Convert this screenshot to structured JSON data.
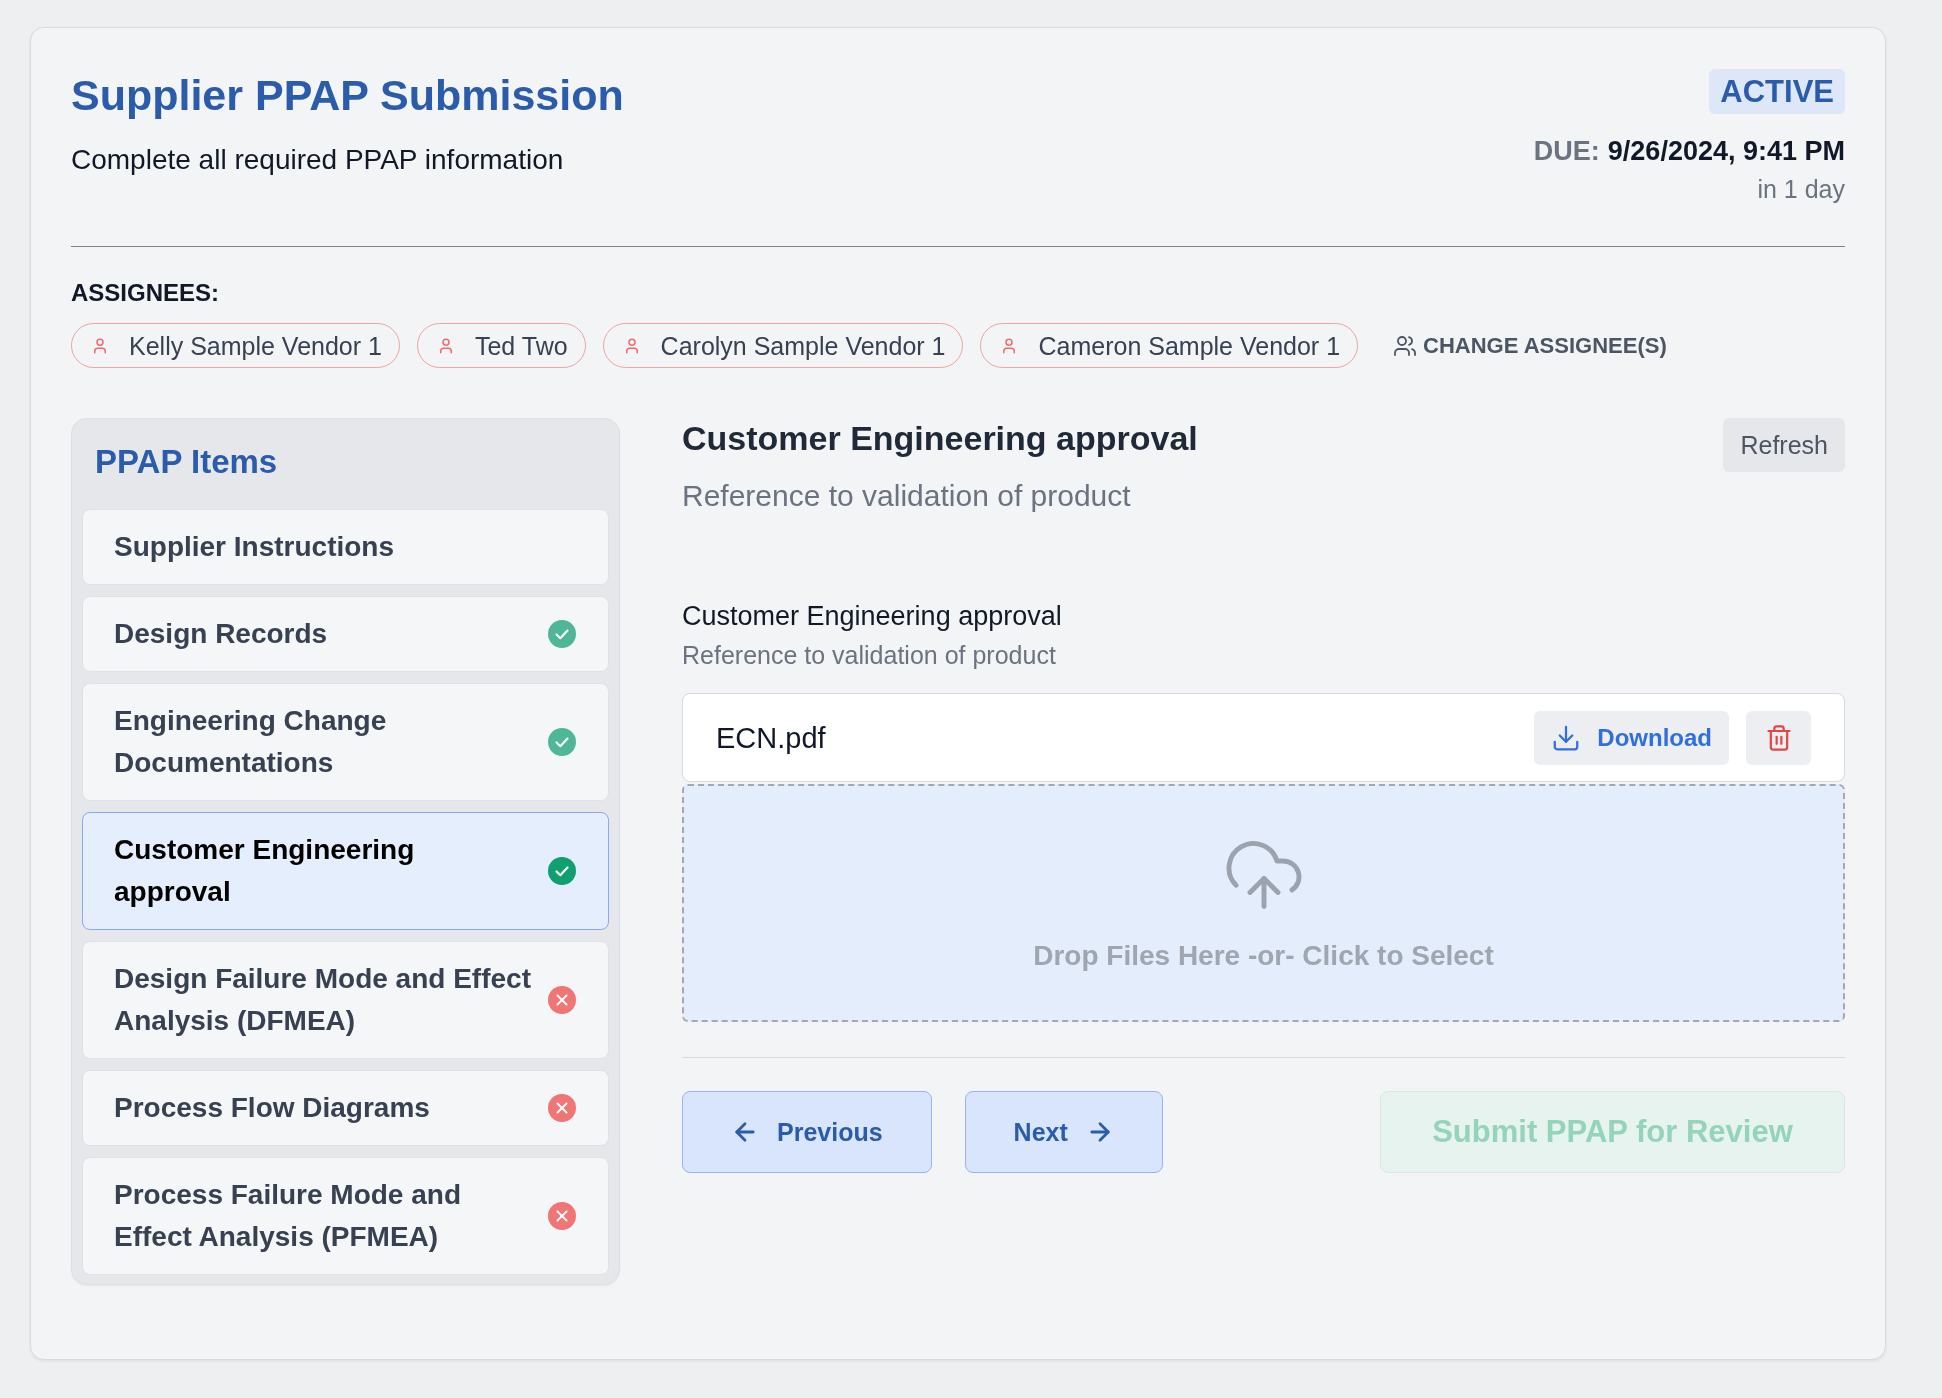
{
  "header": {
    "title": "Supplier PPAP Submission",
    "subtitle": "Complete all required PPAP information",
    "status_badge": "ACTIVE",
    "due_label": "DUE:",
    "due_date": "9/26/2024, 9:41 PM",
    "due_relative": "in 1 day"
  },
  "assignees": {
    "label": "ASSIGNEES:",
    "people": [
      "Kelly Sample Vendor 1",
      "Ted Two",
      "Carolyn Sample Vendor 1",
      "Cameron Sample Vendor 1"
    ],
    "change_button": "CHANGE ASSIGNEE(S)"
  },
  "ppap_items": {
    "title": "PPAP Items",
    "items": [
      {
        "label": "Supplier Instructions",
        "selected": false
      },
      {
        "label": "Design Records",
        "complete": true,
        "selected": false
      },
      {
        "label": "Engineering Change Documentations",
        "complete": true,
        "selected": false
      },
      {
        "label": "Customer Engineering approval",
        "complete": true,
        "selected": true
      },
      {
        "label": "Design Failure Mode and Effect Analysis (DFMEA)",
        "complete": false,
        "selected": false
      },
      {
        "label": "Process Flow Diagrams",
        "complete": false,
        "selected": false
      },
      {
        "label": "Process Failure Mode and Effect Analysis (PFMEA)",
        "complete": false,
        "selected": false
      }
    ]
  },
  "detail": {
    "title": "Customer Engineering approval",
    "description": "Reference to validation of product",
    "refresh_button": "Refresh",
    "field": {
      "label": "Customer Engineering approval",
      "description": "Reference to validation of product",
      "files": [
        {
          "name": "ECN.pdf",
          "download_button": "Download"
        }
      ],
      "dropzone": "Drop Files Here -or- Click to Select"
    }
  },
  "footer": {
    "previous_button": "Previous",
    "next_button": "Next",
    "submit_button": {
      "label": "Submit PPAP for Review",
      "disabled": true
    }
  }
}
